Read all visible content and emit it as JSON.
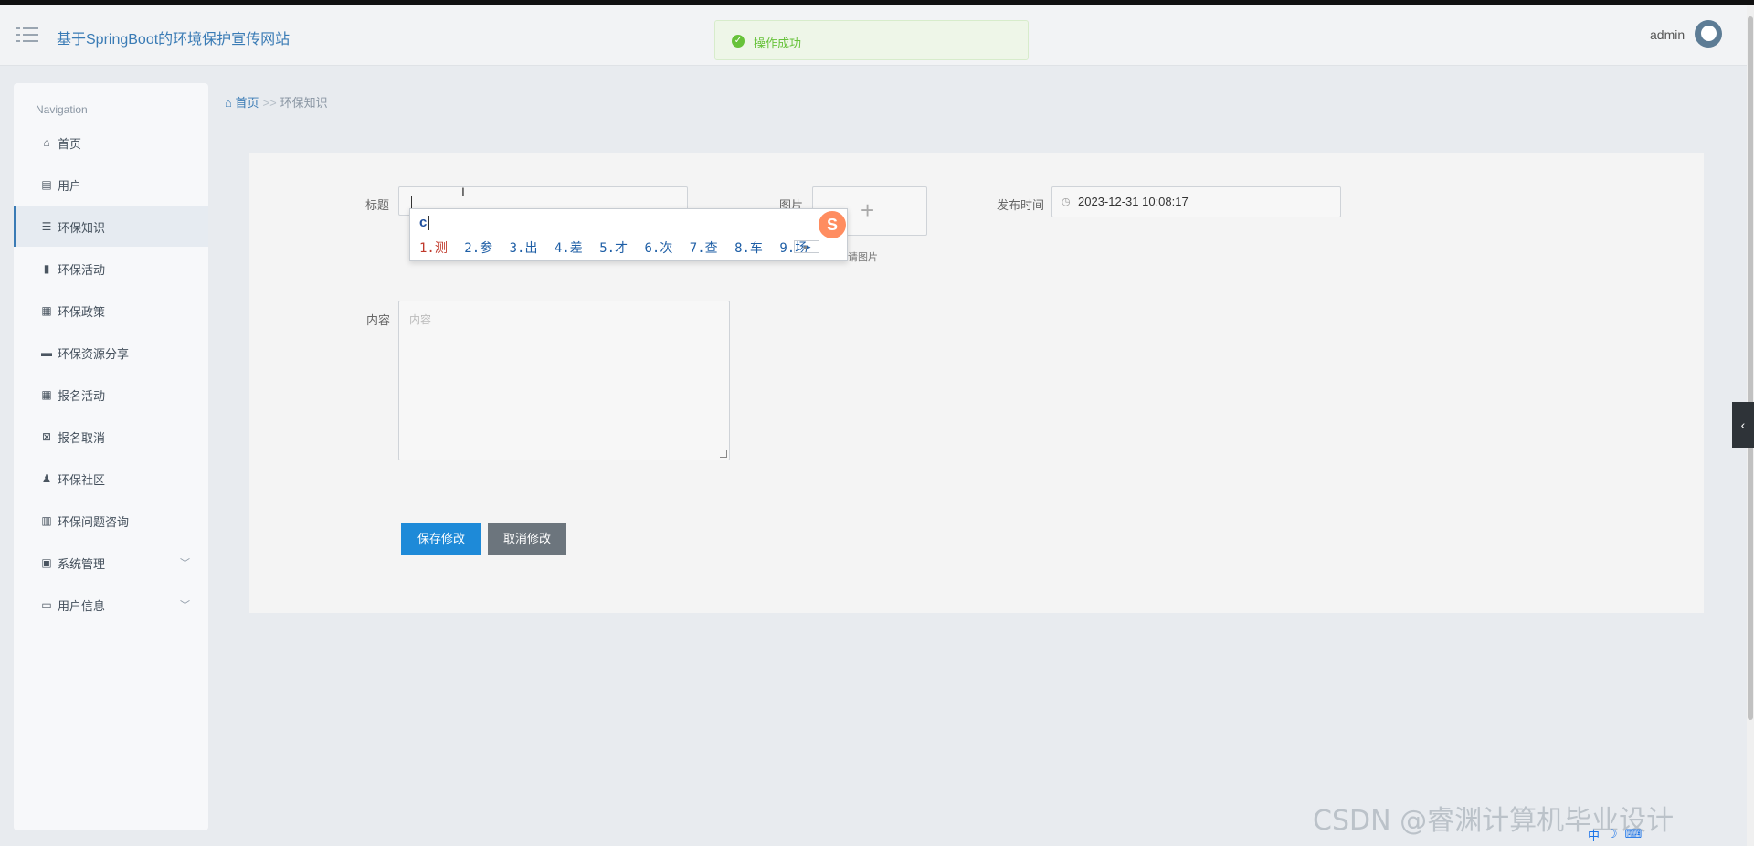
{
  "header": {
    "title": "基于SpringBoot的环境保护宣传网站",
    "user": "admin",
    "toast": "操作成功"
  },
  "sidebar": {
    "caption": "Navigation",
    "items": [
      {
        "label": "首页",
        "icon": "home-icon"
      },
      {
        "label": "用户",
        "icon": "clipboard-icon"
      },
      {
        "label": "环保知识",
        "icon": "list-icon"
      },
      {
        "label": "环保活动",
        "icon": "bar-chart-icon"
      },
      {
        "label": "环保政策",
        "icon": "grid-icon"
      },
      {
        "label": "环保资源分享",
        "icon": "printer-icon"
      },
      {
        "label": "报名活动",
        "icon": "grid-icon"
      },
      {
        "label": "报名取消",
        "icon": "clipboard-x-icon"
      },
      {
        "label": "环保社区",
        "icon": "user-icon"
      },
      {
        "label": "环保问题咨询",
        "icon": "columns-icon"
      },
      {
        "label": "系统管理",
        "icon": "briefcase-icon"
      },
      {
        "label": "用户信息",
        "icon": "card-icon"
      }
    ]
  },
  "breadcrumb": {
    "home": "首页",
    "sep": ">>",
    "current": "环保知识"
  },
  "form": {
    "title_label": "标题",
    "title_value": "",
    "image_label": "图片",
    "image_hint": "请上传图片",
    "image_hint_visible": "请图片",
    "publish_label": "发布时间",
    "publish_value": "2023-12-31 10:08:17",
    "content_label": "内容",
    "content_placeholder": "内容",
    "save_label": "保存修改",
    "cancel_label": "取消修改"
  },
  "ime": {
    "typed": "c",
    "candidates": [
      "1.测",
      "2.参",
      "3.出",
      "4.差",
      "5.才",
      "6.次",
      "7.查",
      "8.车",
      "9.场"
    ],
    "logo": "S"
  },
  "watermark": "CSDN @睿渊计算机毕业设计",
  "tray": [
    "中",
    "☽",
    "⌨"
  ]
}
